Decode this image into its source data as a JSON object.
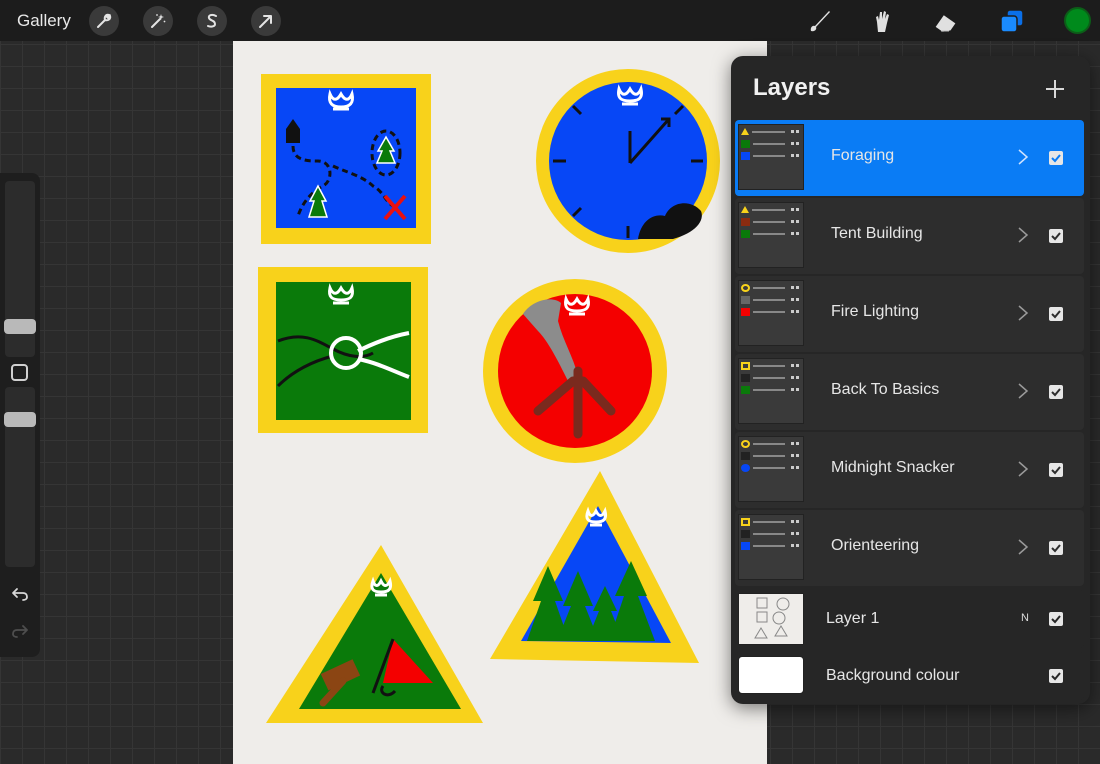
{
  "topbar": {
    "gallery_label": "Gallery",
    "left_tools": [
      "wrench-icon",
      "magic-wand-icon",
      "selection-s-icon",
      "transform-arrow-icon"
    ],
    "right_tools": [
      "brush-icon",
      "smudge-icon",
      "eraser-icon",
      "layers-icon"
    ],
    "active_color": "#008a1c"
  },
  "canvas": {
    "badges": [
      {
        "name": "orienteering-badge",
        "shape": "square",
        "border": "#f8d21b",
        "fill": "#0747f6",
        "icons": [
          "fleur-de-lis-icon",
          "tree-icon",
          "tree-icon",
          "x-mark-icon",
          "house-icon"
        ]
      },
      {
        "name": "midnight-snacker-badge",
        "shape": "circle",
        "border": "#f8d21b",
        "fill": "#0747f6",
        "icons": [
          "fleur-de-lis-icon",
          "clock-hands-icon",
          "bush-icon"
        ]
      },
      {
        "name": "back-to-basics-badge",
        "shape": "square",
        "border": "#f8d21b",
        "fill": "#0a7a0a",
        "icons": [
          "fleur-de-lis-icon",
          "knot-icon"
        ]
      },
      {
        "name": "fire-lighting-badge",
        "shape": "circle",
        "border": "#f8d21b",
        "fill": "#f40000",
        "icons": [
          "fleur-de-lis-icon",
          "smoke-icon",
          "logs-icon"
        ]
      },
      {
        "name": "tent-building-badge",
        "shape": "triangle",
        "border": "#f8d21b",
        "fill": "#0a7a0a",
        "icons": [
          "fleur-de-lis-icon",
          "mallet-icon",
          "tent-icon"
        ]
      },
      {
        "name": "foraging-badge",
        "shape": "triangle",
        "border": "#f8d21b",
        "fill": "#0747f6",
        "icons": [
          "fleur-de-lis-icon",
          "pine-trees-icon"
        ]
      }
    ]
  },
  "layers": {
    "title": "Layers",
    "add_icon": "plus-icon",
    "items": [
      {
        "name": "Foraging",
        "thumb_shape": "triangle",
        "swatches": [
          "#333333",
          "#0a7a0a",
          "#0747f6"
        ],
        "selected": true,
        "visible": true
      },
      {
        "name": "Tent Building",
        "thumb_shape": "triangle",
        "swatches": [
          "#333333",
          "#8b2b10",
          "#0a7a0a"
        ],
        "selected": false,
        "visible": true
      },
      {
        "name": "Fire Lighting",
        "thumb_shape": "circle",
        "swatches": [
          "#333333",
          "#555555",
          "#f40000"
        ],
        "selected": false,
        "visible": true
      },
      {
        "name": "Back To Basics",
        "thumb_shape": "square",
        "swatches": [
          "#333333",
          "#222222",
          "#0a7a0a"
        ],
        "selected": false,
        "visible": true
      },
      {
        "name": "Midnight Snacker",
        "thumb_shape": "circle",
        "swatches": [
          "#333333",
          "#222222",
          "#0747f6"
        ],
        "selected": false,
        "visible": true
      },
      {
        "name": "Orienteering",
        "thumb_shape": "square",
        "swatches": [
          "#333333",
          "#222222",
          "#0747f6"
        ],
        "selected": false,
        "visible": true
      }
    ],
    "layer1": {
      "name": "Layer 1",
      "blend": "N",
      "visible": true
    },
    "background": {
      "name": "Background colour",
      "color": "#ffffff",
      "visible": true
    }
  }
}
